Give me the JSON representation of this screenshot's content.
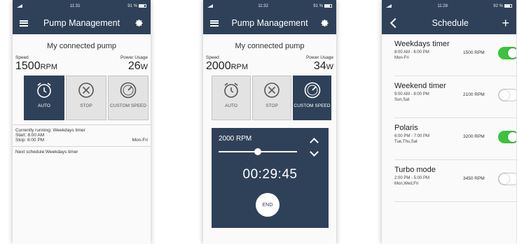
{
  "screens": [
    {
      "status_time": "11:31",
      "status_right": "91 %",
      "title": "Pump Management",
      "pump_name": "My connected pump",
      "speed_label": "Speed",
      "power_label": "Power Usage",
      "speed_value": "1500",
      "speed_unit": "RPM",
      "power_value": "26",
      "power_unit": "W",
      "modes": [
        {
          "label": "AUTO",
          "icon": "alarm-clock-icon",
          "active": true
        },
        {
          "label": "STOP",
          "icon": "stop-circle-icon",
          "active": false
        },
        {
          "label": "CUSTOM SPEED",
          "icon": "speed-gauge-icon",
          "active": false
        }
      ],
      "running_text": "Currently running: Weekdays timer",
      "start_text": "Start: 8:00 AM",
      "stop_text": "Stop: 6:00 PM",
      "days_text": "Mon-Fri",
      "next_schedule_text": "Next schedule:Weekdays timer"
    },
    {
      "status_time": "11:32",
      "status_right": "91 %",
      "title": "Pump Management",
      "pump_name": "My connected pump",
      "speed_label": "Speed",
      "power_label": "Power Usage",
      "speed_value": "2000",
      "speed_unit": "RPM",
      "power_value": "34",
      "power_unit": "W",
      "modes": [
        {
          "label": "AUTO",
          "icon": "alarm-clock-icon",
          "active": false
        },
        {
          "label": "STOP",
          "icon": "stop-circle-icon",
          "active": false
        },
        {
          "label": "CUSTOM SPEED",
          "icon": "speed-gauge-icon",
          "active": true
        }
      ],
      "custom_rpm": "2000 RPM",
      "slider_level": 0.5,
      "timer": "00:29:45",
      "end_label": "END"
    },
    {
      "status_time": "11:28",
      "status_right": "92 %",
      "title": "Schedule",
      "items": [
        {
          "name": "Weekdays timer",
          "time": "8:00 AM - 6:00 PM",
          "days": "Mon-Fri",
          "rpm": "1500 RPM",
          "enabled": true
        },
        {
          "name": "Weekend timer",
          "time": "9:00 AM - 8:00 PM",
          "days": "Sun,Sat",
          "rpm": "2100 RPM",
          "enabled": false
        },
        {
          "name": "Polaris",
          "time": "6:00 PM - 7:00 PM",
          "days": "Tue,Thu,Sat",
          "rpm": "3200 RPM",
          "enabled": true
        },
        {
          "name": "Turbo mode",
          "time": "2:00 PM - 5:00 PM",
          "days": "Mon,Wed,Fri",
          "rpm": "3450 RPM",
          "enabled": false
        }
      ]
    }
  ],
  "colors": {
    "header": "#2f4159",
    "toggle_on": "#3ec23e",
    "mode_inactive": "#e3e3e3"
  }
}
